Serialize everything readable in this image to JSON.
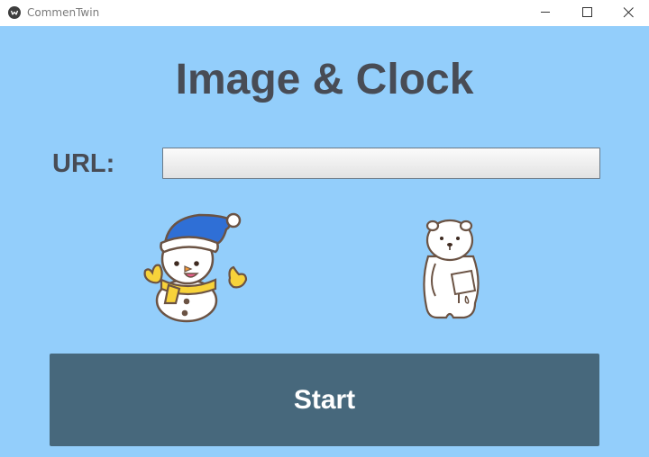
{
  "window": {
    "title": "CommenTwin",
    "icon": "app-logo-icon",
    "controls": [
      "minimize-icon",
      "maximize-icon",
      "close-icon"
    ]
  },
  "main": {
    "heading": "Image & Clock",
    "url_label": "URL:",
    "url_value": "",
    "start_label": "Start"
  },
  "images": [
    "snowman-image",
    "polar-bear-image"
  ],
  "colors": {
    "background": "#93cefb",
    "heading_text": "#484c55",
    "start_button": "#47687c",
    "start_text": "#ffffff"
  }
}
